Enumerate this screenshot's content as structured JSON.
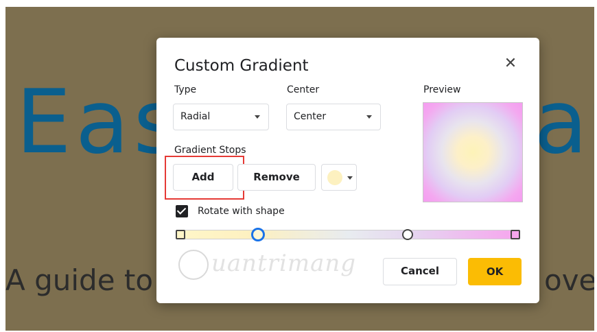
{
  "background": {
    "title_left": "Eas",
    "title_right": "at",
    "subtitle_left": "A guide to",
    "subtitle_right": "ove i"
  },
  "dialog": {
    "title": "Custom Gradient",
    "close_icon": "close-icon",
    "type_label": "Type",
    "type_value": "Radial",
    "center_label": "Center",
    "center_value": "Center",
    "preview_label": "Preview",
    "gradient_stops_label": "Gradient Stops",
    "add_label": "Add",
    "remove_label": "Remove",
    "stop_color": "#fdf1c0",
    "rotate_label": "Rotate with shape",
    "rotate_checked": true,
    "cancel_label": "Cancel",
    "ok_label": "OK",
    "ok_color": "#fbbc04"
  },
  "watermark": {
    "text": "uantrimang"
  }
}
